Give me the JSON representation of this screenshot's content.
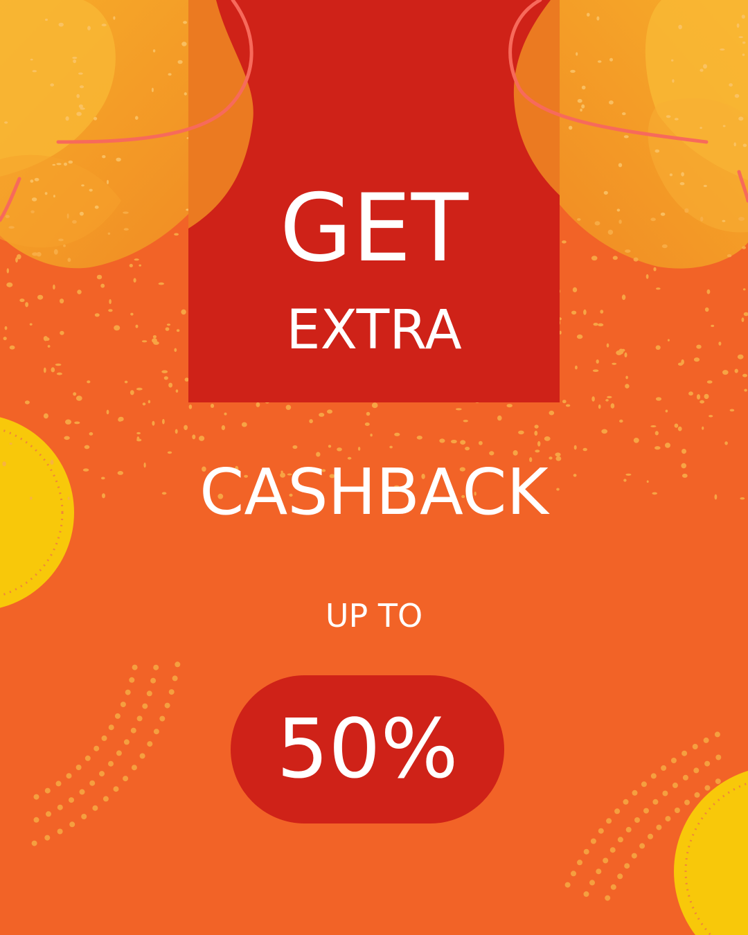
{
  "headline": {
    "line1": "GET",
    "line2": "EXTRA",
    "line3": "CASHBACK"
  },
  "offer": {
    "prefix": "UP TO",
    "value": "50%"
  },
  "colors": {
    "background": "#f26327",
    "panel": "#cf2218",
    "accent_yellow": "#f8c80a",
    "accent_orange": "#f39a24",
    "text": "#ffffff"
  }
}
